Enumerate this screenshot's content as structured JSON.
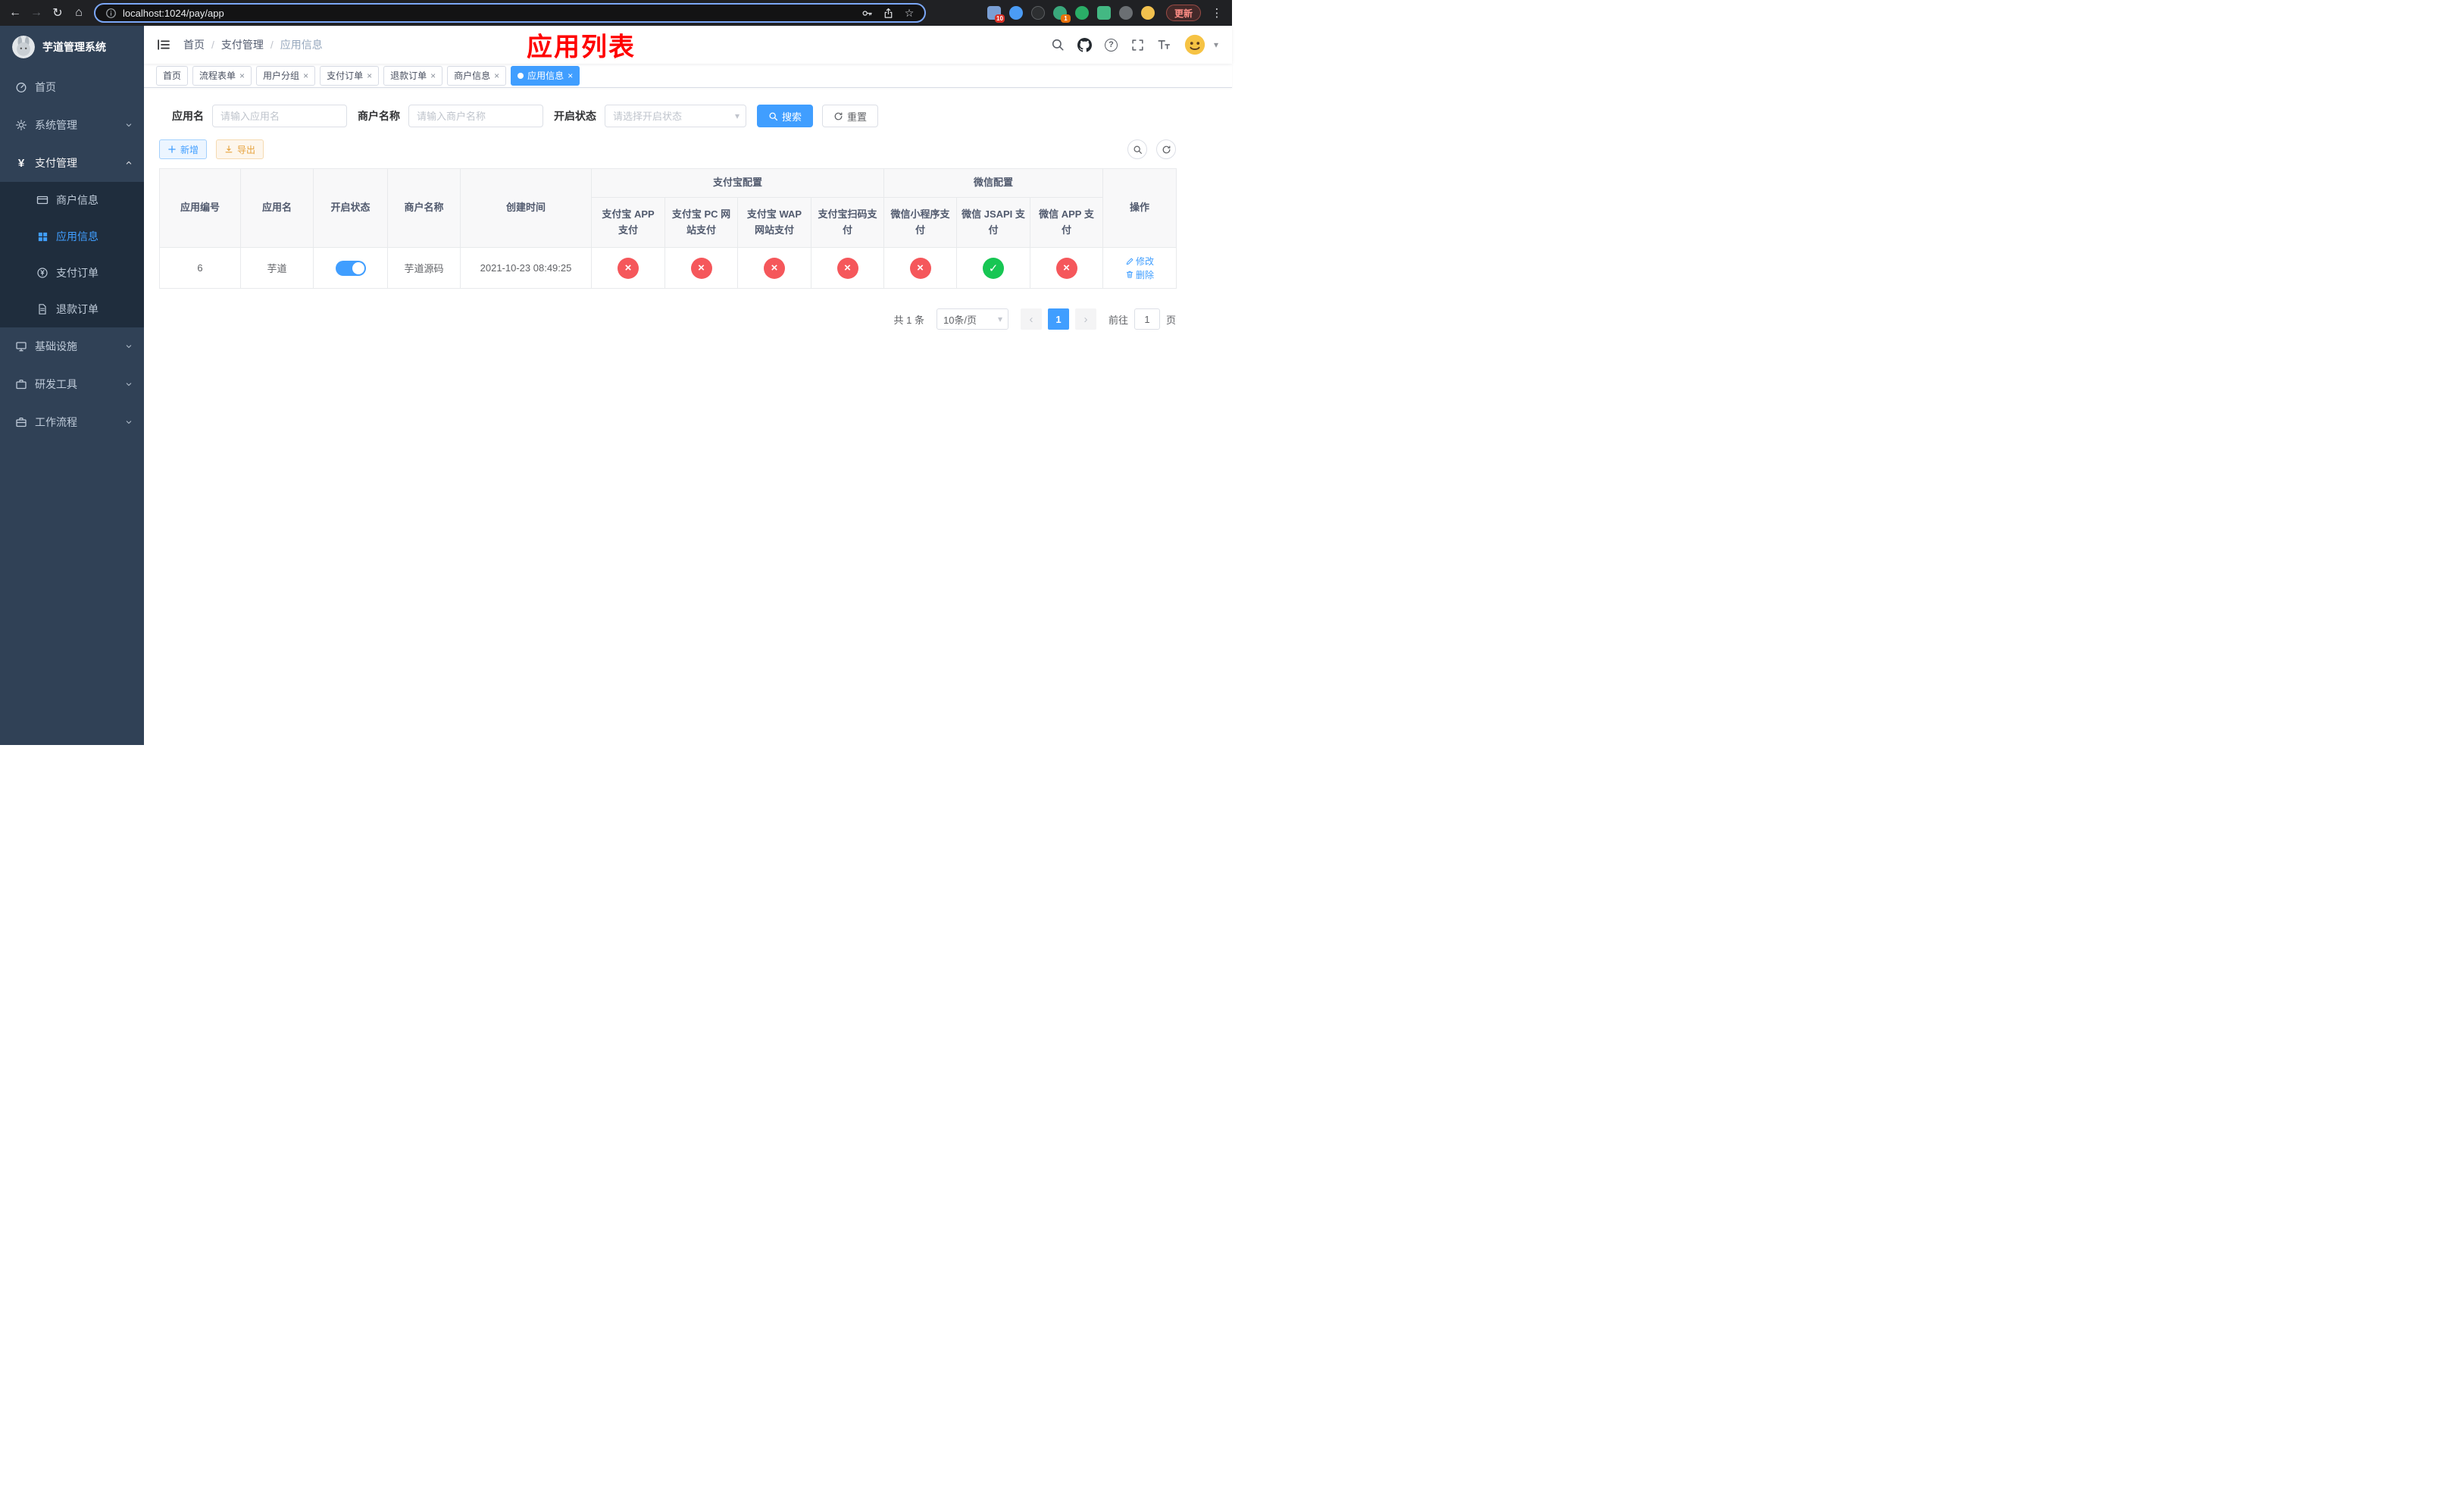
{
  "browser": {
    "url": "localhost:1024/pay/app",
    "update_button": "更新",
    "ext_badge_blue": "10",
    "ext_badge_teal": "1"
  },
  "icons": {
    "back": "←",
    "forward": "→",
    "reload": "↻",
    "home": "⌂",
    "star": "☆",
    "kebab": "⋮",
    "question": "?",
    "caret_down": "▾",
    "chevron_select": "▾",
    "yen": "¥",
    "close": "×",
    "cross": "×",
    "check": "✓",
    "prev": "‹",
    "next": "›",
    "separator": "/"
  },
  "sidebar": {
    "app_title": "芋道管理系统",
    "menu": {
      "home": "首页",
      "system": "系统管理",
      "payment": "支付管理",
      "merchant": "商户信息",
      "app_info": "应用信息",
      "pay_order": "支付订单",
      "refund_order": "退款订单",
      "infra": "基础设施",
      "dev_tools": "研发工具",
      "workflow": "工作流程"
    }
  },
  "header": {
    "breadcrumb": {
      "home": "首页",
      "section": "支付管理",
      "page": "应用信息"
    },
    "annotation": "应用列表",
    "annotation_color": "#ff0000"
  },
  "tabs": [
    {
      "label": "首页"
    },
    {
      "label": "流程表单"
    },
    {
      "label": "用户分组"
    },
    {
      "label": "支付订单"
    },
    {
      "label": "退款订单"
    },
    {
      "label": "商户信息"
    },
    {
      "label": "应用信息"
    }
  ],
  "filters": {
    "app_name_label": "应用名",
    "app_name_placeholder": "请输入应用名",
    "merchant_label": "商户名称",
    "merchant_placeholder": "请输入商户名称",
    "status_label": "开启状态",
    "status_placeholder": "请选择开启状态",
    "search_button": "搜索",
    "reset_button": "重置"
  },
  "toolbar": {
    "add_button": "新增",
    "export_button": "导出"
  },
  "table": {
    "headers": {
      "app_id": "应用编号",
      "app_name": "应用名",
      "status": "开启状态",
      "merchant_name": "商户名称",
      "create_time": "创建时间",
      "alipay_group": "支付宝配置",
      "wechat_group": "微信配置",
      "actions": "操作",
      "alipay_app": "支付宝 APP 支付",
      "alipay_pc": "支付宝 PC 网站支付",
      "alipay_wap": "支付宝 WAP 网站支付",
      "alipay_qr": "支付宝扫码支付",
      "wx_lite": "微信小程序支付",
      "wx_jsapi": "微信 JSAPI 支付",
      "wx_app": "微信 APP 支付"
    },
    "row": {
      "app_id": "6",
      "app_name": "芋道",
      "status_on": true,
      "merchant_name": "芋道源码",
      "create_time": "2021-10-23 08:49:25",
      "alipay_app": "disabled",
      "alipay_pc": "disabled",
      "alipay_wap": "disabled",
      "alipay_qr": "disabled",
      "wx_lite": "disabled",
      "wx_jsapi": "enabled",
      "wx_app": "disabled",
      "edit_label": "修改",
      "delete_label": "删除"
    }
  },
  "pagination": {
    "total": "共 1 条",
    "page_size": "10条/页",
    "current_page": "1",
    "goto_label": "前往",
    "goto_value": "1",
    "page_suffix": "页"
  },
  "colors": {
    "primary": "#409eff",
    "danger": "#f5575b",
    "success": "#17c653",
    "warning": "#e6a23c",
    "annotation_red": "#ff0000",
    "sidebar_bg": "#304156",
    "submenu_bg": "#1f2d3d"
  }
}
